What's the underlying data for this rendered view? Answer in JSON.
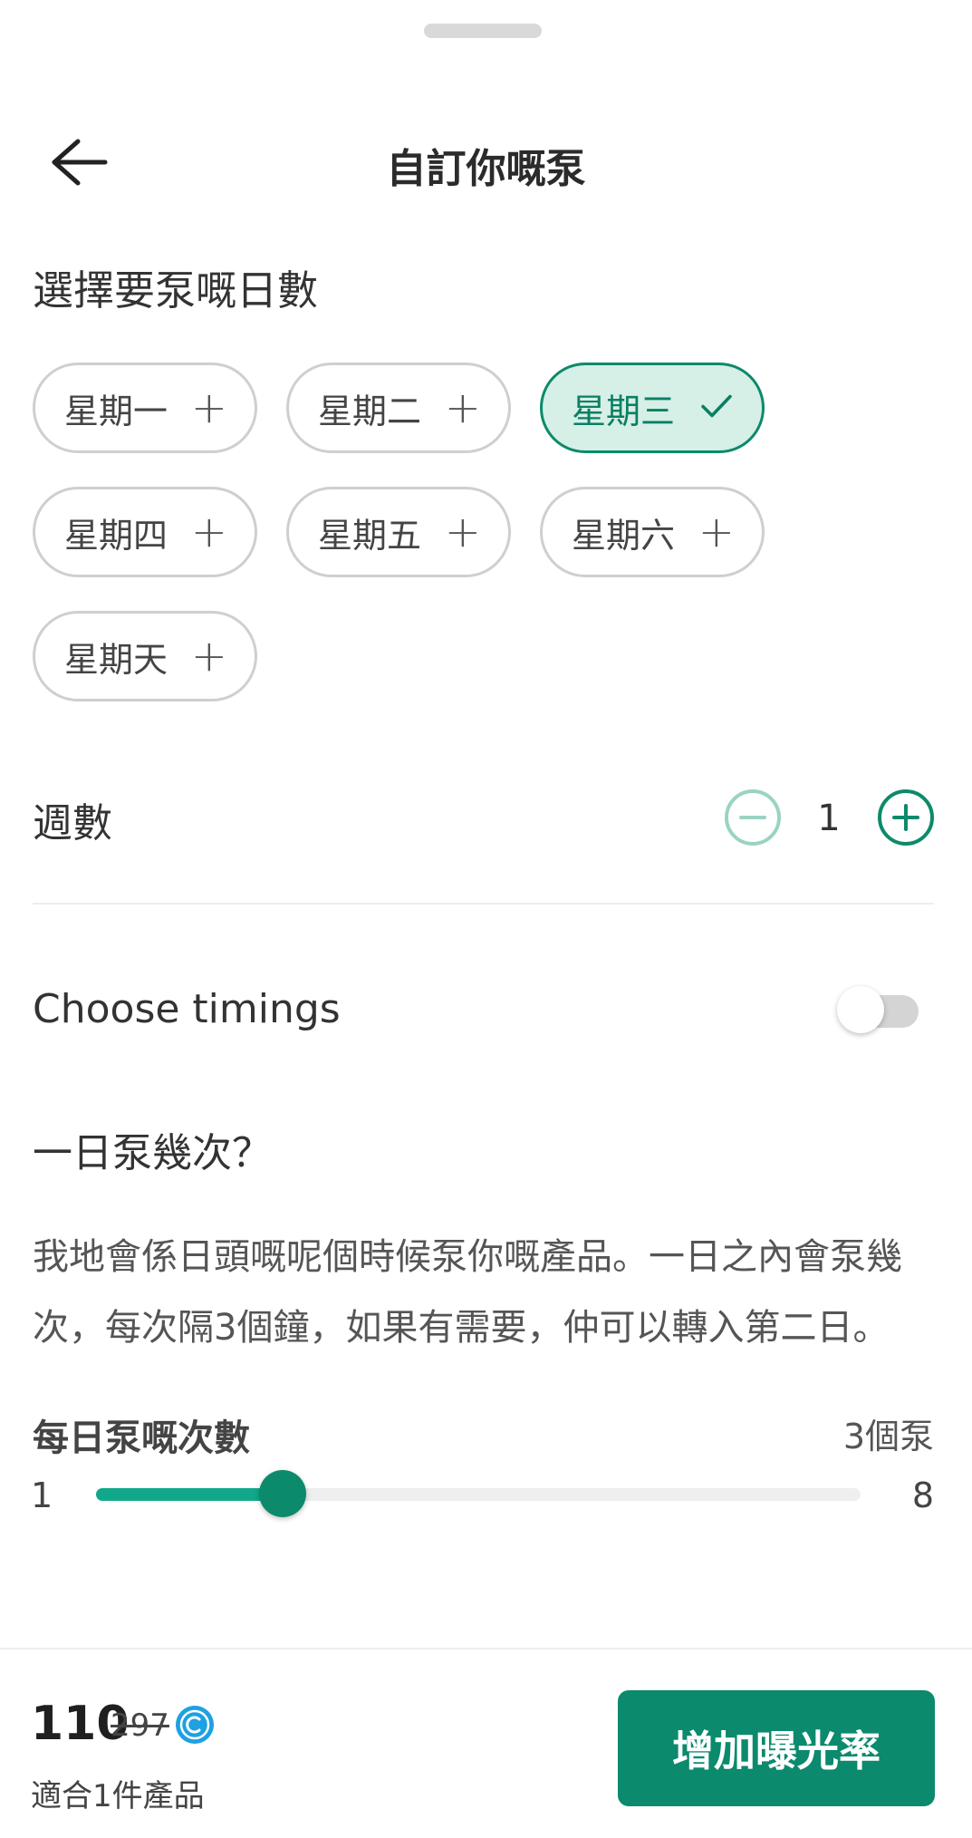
{
  "header": {
    "title": "自訂你嘅泵"
  },
  "days_section": {
    "label": "選擇要泵嘅日數"
  },
  "days": [
    {
      "label": "星期一",
      "selected": false
    },
    {
      "label": "星期二",
      "selected": false
    },
    {
      "label": "星期三",
      "selected": true
    },
    {
      "label": "星期四",
      "selected": false
    },
    {
      "label": "星期五",
      "selected": false
    },
    {
      "label": "星期六",
      "selected": false
    },
    {
      "label": "星期天",
      "selected": false
    }
  ],
  "weeks": {
    "label": "週數",
    "value": "1"
  },
  "timings": {
    "label": "Choose timings",
    "enabled": false
  },
  "frequency": {
    "heading": "一日泵幾次？",
    "description": "我地會係日頭嘅呢個時候泵你嘅產品。一日之內會泵幾次，每次隔3個鐘，如果有需要，仲可以轉入第二日。"
  },
  "slider": {
    "label": "每日泵嘅次數",
    "value_text": "3個泵",
    "min": "1",
    "max": "8",
    "value": 3
  },
  "footer": {
    "price": "110",
    "old_price": "297",
    "product_count": "適合1件產品",
    "cta_label": "增加曝光率"
  },
  "colors": {
    "accent": "#0b8a6d",
    "accent_light": "#d6efe7",
    "slider_fill": "#11a88a",
    "coin": "#1da1e2"
  },
  "icons": {
    "back": "arrow-left-icon",
    "add": "plus-icon",
    "selected": "check-icon",
    "decrement": "minus-circle-icon",
    "increment": "plus-circle-icon",
    "currency": "coin-icon"
  }
}
